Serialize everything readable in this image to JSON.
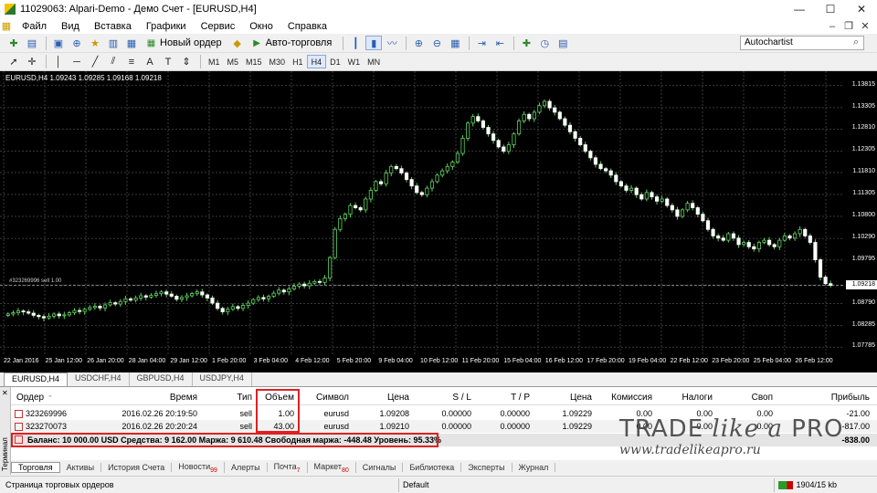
{
  "window": {
    "title": "11029063: Alpari-Demo - Демо Счет - [EURUSD,H4]"
  },
  "menu": [
    "Файл",
    "Вид",
    "Вставка",
    "Графики",
    "Сервис",
    "Окно",
    "Справка"
  ],
  "toolbar": {
    "new_order": "Новый ордер",
    "auto_trading": "Авто-торговля",
    "search_value": "Autochartist"
  },
  "timeframes": [
    "M1",
    "M5",
    "M15",
    "M30",
    "H1",
    "H4",
    "D1",
    "W1",
    "MN"
  ],
  "active_timeframe": "H4",
  "chart": {
    "label": "EURUSD,H4 1.09243 1.09285 1.09168 1.09218",
    "order_line_label": "#323269996 sell 1.00",
    "current_price": "1.09218"
  },
  "chart_data": {
    "type": "candlestick",
    "symbol": "EURUSD",
    "timeframe": "H4",
    "y_ticks": [
      "1.13815",
      "1.13305",
      "1.12810",
      "1.12305",
      "1.11810",
      "1.11305",
      "1.10800",
      "1.10290",
      "1.09795",
      "1.09218",
      "1.08790",
      "1.08285",
      "1.07785"
    ],
    "x_ticks": [
      "22 Jan 2016",
      "25 Jan 12:00",
      "26 Jan 20:00",
      "28 Jan 04:00",
      "29 Jan 12:00",
      "1 Feb 20:00",
      "3 Feb 04:00",
      "4 Feb 12:00",
      "5 Feb 20:00",
      "9 Feb 04:00",
      "10 Feb 12:00",
      "11 Feb 20:00",
      "15 Feb 04:00",
      "16 Feb 12:00",
      "17 Feb 20:00",
      "19 Feb 04:00",
      "22 Feb 12:00",
      "23 Feb 20:00",
      "25 Feb 04:00",
      "26 Feb 12:00"
    ],
    "ylim": [
      1.0775,
      1.1385
    ],
    "close": [
      1.0855,
      1.0858,
      1.0862,
      1.086,
      1.0857,
      1.0852,
      1.0849,
      1.0846,
      1.085,
      1.0855,
      1.0851,
      1.0853,
      1.0858,
      1.0863,
      1.0861,
      1.0866,
      1.087,
      1.0873,
      1.0869,
      1.0876,
      1.0881,
      1.0878,
      1.0884,
      1.089,
      1.0887,
      1.0892,
      1.0897,
      1.0894,
      1.0898,
      1.0902,
      1.0906,
      1.0901,
      1.0896,
      1.0889,
      1.0893,
      1.0897,
      1.0902,
      1.0906,
      1.0899,
      1.0892,
      1.088,
      1.0868,
      1.086,
      1.0866,
      1.0872,
      1.0868,
      1.0875,
      1.088,
      1.0888,
      1.0893,
      1.089,
      1.0896,
      1.0903,
      1.091,
      1.0906,
      1.0913,
      1.0919,
      1.0924,
      1.092,
      1.0926,
      1.093,
      1.0928,
      1.0938,
      1.0985,
      1.105,
      1.1075,
      1.1085,
      1.1105,
      1.11,
      1.1095,
      1.112,
      1.114,
      1.116,
      1.1155,
      1.118,
      1.1195,
      1.119,
      1.118,
      1.1165,
      1.115,
      1.1135,
      1.113,
      1.1145,
      1.116,
      1.1175,
      1.1185,
      1.1195,
      1.1205,
      1.1225,
      1.126,
      1.1295,
      1.131,
      1.13,
      1.1285,
      1.127,
      1.1255,
      1.124,
      1.123,
      1.1245,
      1.127,
      1.13,
      1.1315,
      1.1305,
      1.132,
      1.1335,
      1.1345,
      1.133,
      1.132,
      1.1305,
      1.129,
      1.1275,
      1.126,
      1.1245,
      1.123,
      1.1215,
      1.12,
      1.119,
      1.1185,
      1.1175,
      1.116,
      1.115,
      1.114,
      1.1145,
      1.113,
      1.112,
      1.1135,
      1.1125,
      1.1115,
      1.112,
      1.1105,
      1.1095,
      1.108,
      1.1095,
      1.111,
      1.11,
      1.1085,
      1.107,
      1.105,
      1.1035,
      1.103,
      1.1025,
      1.104,
      1.103,
      1.1015,
      1.102,
      1.101,
      1.1005,
      1.102,
      1.1025,
      1.1015,
      1.101,
      1.1025,
      1.1035,
      1.103,
      1.104,
      1.105,
      1.1035,
      1.102,
      1.098,
      1.094,
      1.0925,
      1.0921
    ]
  },
  "chart_tabs": [
    "EURUSD,H4",
    "USDCHF,H4",
    "GBPUSD,H4",
    "USDJPY,H4"
  ],
  "terminal": {
    "side_label": "Терминал",
    "columns": {
      "order": "Ордер",
      "time": "Время",
      "type": "Тип",
      "volume": "Объем",
      "symbol": "Символ",
      "price": "Цена",
      "sl": "S / L",
      "tp": "T / P",
      "price2": "Цена",
      "commission": "Комиссия",
      "taxes": "Налоги",
      "swap": "Своп",
      "profit": "Прибыль"
    },
    "rows": [
      {
        "order": "323269996",
        "time": "2016.02.26 20:19:50",
        "type": "sell",
        "volume": "1.00",
        "symbol": "eurusd",
        "price": "1.09208",
        "sl": "0.00000",
        "tp": "0.00000",
        "price2": "1.09229",
        "commission": "0.00",
        "taxes": "0.00",
        "swap": "0.00",
        "profit": "-21.00"
      },
      {
        "order": "323270073",
        "time": "2016.02.26 20:20:24",
        "type": "sell",
        "volume": "43.00",
        "symbol": "eurusd",
        "price": "1.09210",
        "sl": "0.00000",
        "tp": "0.00000",
        "price2": "1.09229",
        "commission": "0.00",
        "taxes": "0.00",
        "swap": "0.00",
        "profit": "-817.00"
      }
    ],
    "balance_line": "Баланс: 10 000.00 USD  Средства: 9 162.00  Маржа: 9 610.48  Свободная маржа: -448.48  Уровень: 95.33%",
    "total_profit": "-838.00",
    "tabs": [
      {
        "label": "Торговля",
        "badge": ""
      },
      {
        "label": "Активы",
        "badge": ""
      },
      {
        "label": "История Счета",
        "badge": ""
      },
      {
        "label": "Новости",
        "badge": "99"
      },
      {
        "label": "Алерты",
        "badge": ""
      },
      {
        "label": "Почта",
        "badge": "7"
      },
      {
        "label": "Маркет",
        "badge": "80"
      },
      {
        "label": "Сигналы",
        "badge": ""
      },
      {
        "label": "Библиотека",
        "badge": ""
      },
      {
        "label": "Эксперты",
        "badge": ""
      },
      {
        "label": "Журнал",
        "badge": ""
      }
    ]
  },
  "status": {
    "left": "Страница торговых ордеров",
    "profile": "Default",
    "connection": "1904/15 kb"
  },
  "watermark": {
    "title_a": "TRADE ",
    "title_b": "like a ",
    "title_c": "PRO",
    "url": "www.tradelikeapro.ru"
  }
}
